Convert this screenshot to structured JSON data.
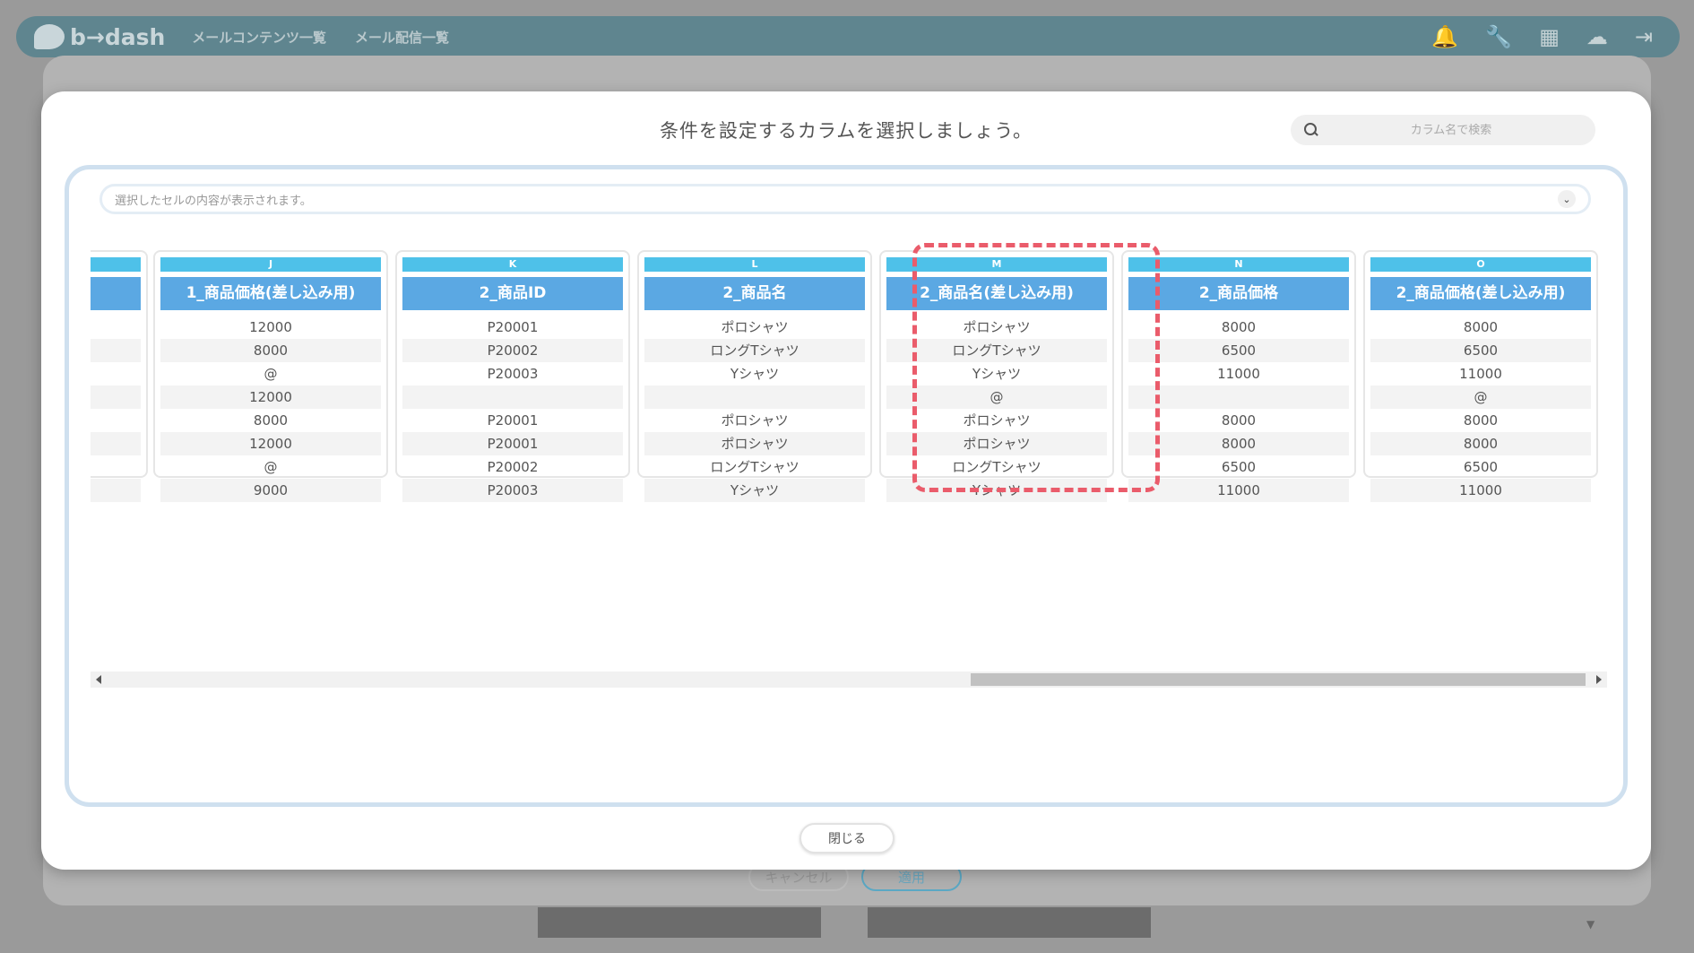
{
  "app": {
    "logo_text": "b→dash",
    "nav": [
      "メールコンテンツ一覧",
      "メール配信一覧"
    ],
    "icons": [
      "bell-icon",
      "wrench-icon",
      "grid-icon",
      "cloud-icon",
      "logout-icon"
    ]
  },
  "background": {
    "cancel_label": "キャンセル",
    "apply_label": "適用"
  },
  "modal": {
    "title": "条件を設定するカラムを選択しましょう。",
    "search_placeholder": "カラム名で検索",
    "cell_preview_placeholder": "選択したセルの内容が表示されます。",
    "close_label": "閉じる"
  },
  "columns": [
    {
      "letter": "J",
      "name": "1_商品価格(差し込み用)",
      "cells": [
        "12000",
        "8000",
        "@",
        "12000",
        "8000",
        "12000",
        "@",
        "9000"
      ]
    },
    {
      "letter": "K",
      "name": "2_商品ID",
      "cells": [
        "P20001",
        "P20002",
        "P20003",
        "",
        "P20001",
        "P20001",
        "P20002",
        "P20003"
      ]
    },
    {
      "letter": "L",
      "name": "2_商品名",
      "cells": [
        "ポロシャツ",
        "ロングTシャツ",
        "Yシャツ",
        "",
        "ポロシャツ",
        "ポロシャツ",
        "ロングTシャツ",
        "Yシャツ"
      ]
    },
    {
      "letter": "M",
      "name": "2_商品名(差し込み用)",
      "cells": [
        "ポロシャツ",
        "ロングTシャツ",
        "Yシャツ",
        "@",
        "ポロシャツ",
        "ポロシャツ",
        "ロングTシャツ",
        "Yシャツ"
      ]
    },
    {
      "letter": "N",
      "name": "2_商品価格",
      "cells": [
        "8000",
        "6500",
        "11000",
        "",
        "8000",
        "8000",
        "6500",
        "11000"
      ]
    },
    {
      "letter": "O",
      "name": "2_商品価格(差し込み用)",
      "cells": [
        "8000",
        "6500",
        "11000",
        "@",
        "8000",
        "8000",
        "6500",
        "11000"
      ]
    }
  ],
  "highlighted_column": "M",
  "colors": {
    "column_letter_bg": "#4ec1e9",
    "column_name_bg": "#5ba8e3",
    "highlight_border": "#ea5c6b"
  }
}
